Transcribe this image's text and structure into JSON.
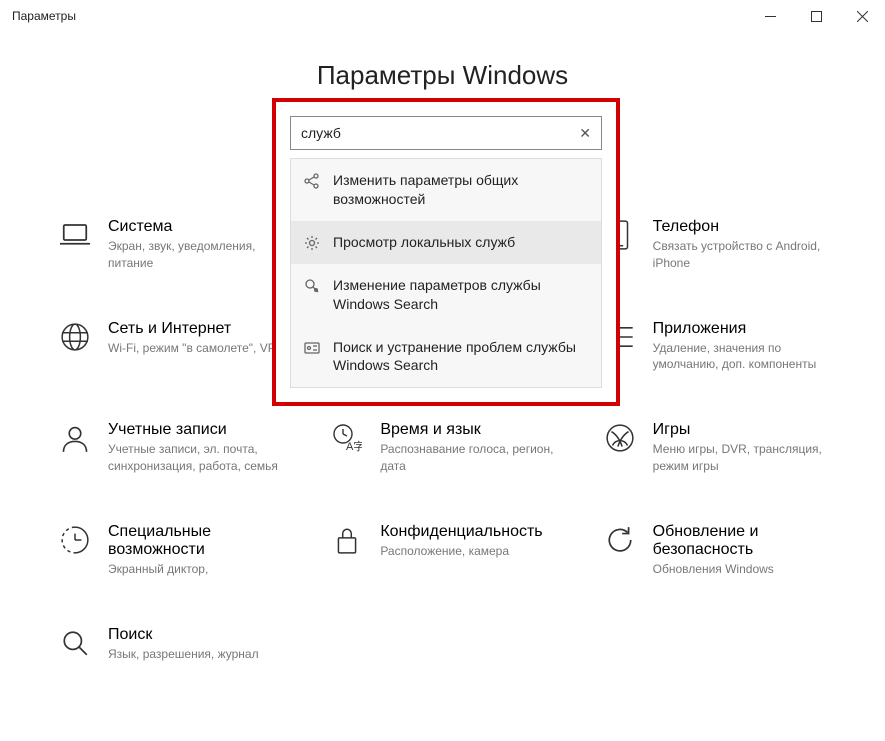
{
  "window": {
    "title": "Параметры"
  },
  "heading": "Параметры Windows",
  "search": {
    "value": "служб",
    "suggestions": [
      {
        "label": "Изменить параметры общих возможностей"
      },
      {
        "label": "Просмотр локальных служб"
      },
      {
        "label": "Изменение параметров службы Windows Search"
      },
      {
        "label": "Поиск и устранение проблем службы Windows Search"
      }
    ]
  },
  "categories": [
    {
      "title": "Система",
      "sub": "Экран, звук, уведомления, питание"
    },
    {
      "title": "Телефон",
      "sub": "Связать устройство с Android, iPhone"
    },
    {
      "title": "Сеть и Интернет",
      "sub": "Wi-Fi, режим \"в самолете\", VPN"
    },
    {
      "title": "Приложения",
      "sub": "Удаление, значения по умолчанию, доп. компоненты"
    },
    {
      "title": "Учетные записи",
      "sub": "Учетные записи, эл. почта, синхронизация, работа, семья"
    },
    {
      "title": "Время и язык",
      "sub": "Распознавание голоса, регион, дата"
    },
    {
      "title": "Игры",
      "sub": "Меню игры, DVR, трансляция, режим игры"
    },
    {
      "title": "Специальные возможности",
      "sub": "Экранный диктор,"
    },
    {
      "title": "Конфиденциальность",
      "sub": "Расположение, камера"
    },
    {
      "title": "Обновление и безопасность",
      "sub": "Обновления Windows"
    },
    {
      "title": "Поиск",
      "sub": "Язык, разрешения, журнал"
    }
  ]
}
